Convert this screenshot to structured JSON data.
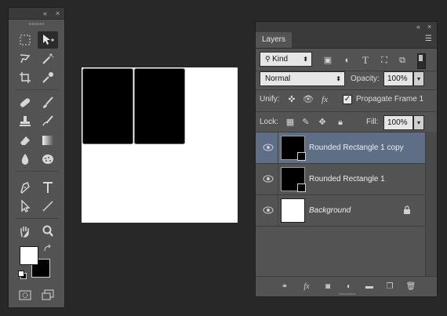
{
  "tools_panel": {
    "collapse_label": "«",
    "close_label": "×"
  },
  "layers_panel": {
    "collapse_label": "«",
    "close_label": "×",
    "tab_label": "Layers",
    "menu_icon": "panel-menu-icon",
    "filter": {
      "kind_label": "Kind",
      "filter_icons": [
        "image-filter-icon",
        "adjustment-filter-icon",
        "type-filter-icon",
        "shape-filter-icon",
        "smart-object-filter-icon"
      ]
    },
    "blend_mode": "Normal",
    "opacity_label": "Opacity:",
    "opacity_value": "100%",
    "unify_label": "Unify:",
    "propagate_label": "Propagate Frame 1",
    "propagate_checked": true,
    "lock_label": "Lock:",
    "fill_label": "Fill:",
    "fill_value": "100%",
    "layers": [
      {
        "name": "Rounded Rectangle 1 copy",
        "visible": true,
        "active": true,
        "type": "shape"
      },
      {
        "name": "Rounded Rectangle 1",
        "visible": true,
        "active": false,
        "type": "shape"
      },
      {
        "name": "Background",
        "visible": true,
        "active": false,
        "type": "background",
        "locked": true
      }
    ],
    "bottom_icons": [
      "link-layers-icon",
      "fx-icon",
      "add-mask-icon",
      "new-adjustment-icon",
      "new-group-icon",
      "new-layer-icon",
      "trash-icon"
    ]
  },
  "colors": {
    "foreground": "#ffffff",
    "background": "#000000",
    "selection_highlight": "#5e6e86",
    "panel_bg": "#535353"
  }
}
